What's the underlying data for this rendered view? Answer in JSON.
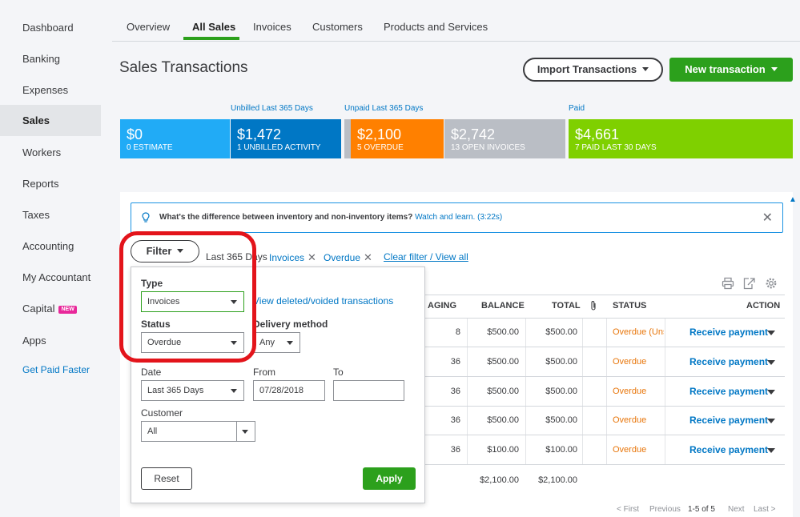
{
  "sidebar": {
    "items": [
      {
        "label": "Dashboard"
      },
      {
        "label": "Banking"
      },
      {
        "label": "Expenses"
      },
      {
        "label": "Sales"
      },
      {
        "label": "Workers"
      },
      {
        "label": "Reports"
      },
      {
        "label": "Taxes"
      },
      {
        "label": "Accounting"
      },
      {
        "label": "My Accountant"
      },
      {
        "label": "Capital"
      },
      {
        "label": "Apps"
      }
    ],
    "new_badge": "NEW",
    "get_paid": "Get Paid Faster"
  },
  "tabs": [
    "Overview",
    "All Sales",
    "Invoices",
    "Customers",
    "Products and Services"
  ],
  "page": {
    "title": "Sales Transactions",
    "import_label": "Import Transactions",
    "new_label": "New transaction"
  },
  "money_bar": {
    "labels": {
      "unbilled": "Unbilled Last 365 Days",
      "unpaid": "Unpaid Last 365 Days",
      "paid": "Paid"
    },
    "blocks": [
      {
        "amount": "$0",
        "sub": "0 ESTIMATE",
        "color": "#21abf6"
      },
      {
        "amount": "$1,472",
        "sub": "1 UNBILLED ACTIVITY",
        "color": "#0077c5"
      },
      {
        "amount": "$2,100",
        "sub": "5 OVERDUE",
        "color": "#ff8000"
      },
      {
        "amount": "$2,742",
        "sub": "13 OPEN INVOICES",
        "color": "#babec5"
      },
      {
        "amount": "$4,661",
        "sub": "7 PAID LAST 30 DAYS",
        "color": "#7fd000"
      }
    ]
  },
  "tip": {
    "text": "What's the difference between inventory and non-inventory items?",
    "link": "Watch and learn. (3:22s)"
  },
  "filter": {
    "button": "Filter",
    "chips": {
      "range": "Last 365 Days",
      "type": "Invoices",
      "status": "Overdue"
    },
    "clear": "Clear filter / View all"
  },
  "dropdown": {
    "type_label": "Type",
    "type_value": "Invoices",
    "view_deleted": "View deleted/voided transactions",
    "status_label": "Status",
    "status_value": "Overdue",
    "delivery_label": "Delivery method",
    "delivery_value": "Any",
    "date_label": "Date",
    "date_value": "Last 365 Days",
    "from_label": "From",
    "from_value": "07/28/2018",
    "to_label": "To",
    "to_value": "",
    "customer_label": "Customer",
    "customer_value": "All",
    "reset": "Reset",
    "apply": "Apply"
  },
  "table": {
    "headers": {
      "aging": "AGING",
      "balance": "BALANCE",
      "total": "TOTAL",
      "status": "STATUS",
      "action": "ACTION"
    },
    "rows": [
      {
        "aging": "8",
        "balance": "$500.00",
        "total": "$500.00",
        "status": "Overdue (Unsent)",
        "action": "Receive payment"
      },
      {
        "aging": "36",
        "balance": "$500.00",
        "total": "$500.00",
        "status": "Overdue",
        "action": "Receive payment"
      },
      {
        "aging": "36",
        "balance": "$500.00",
        "total": "$500.00",
        "status": "Overdue",
        "action": "Receive payment"
      },
      {
        "aging": "36",
        "balance": "$500.00",
        "total": "$500.00",
        "status": "Overdue",
        "action": "Receive payment"
      },
      {
        "aging": "36",
        "balance": "$100.00",
        "total": "$100.00",
        "status": "Overdue",
        "action": "Receive payment"
      }
    ],
    "totals": {
      "balance": "$2,100.00",
      "total": "$2,100.00"
    },
    "pager": {
      "first": "< First",
      "previous": "Previous",
      "range": "1-5 of 5",
      "next": "Next",
      "last": "Last >"
    }
  }
}
